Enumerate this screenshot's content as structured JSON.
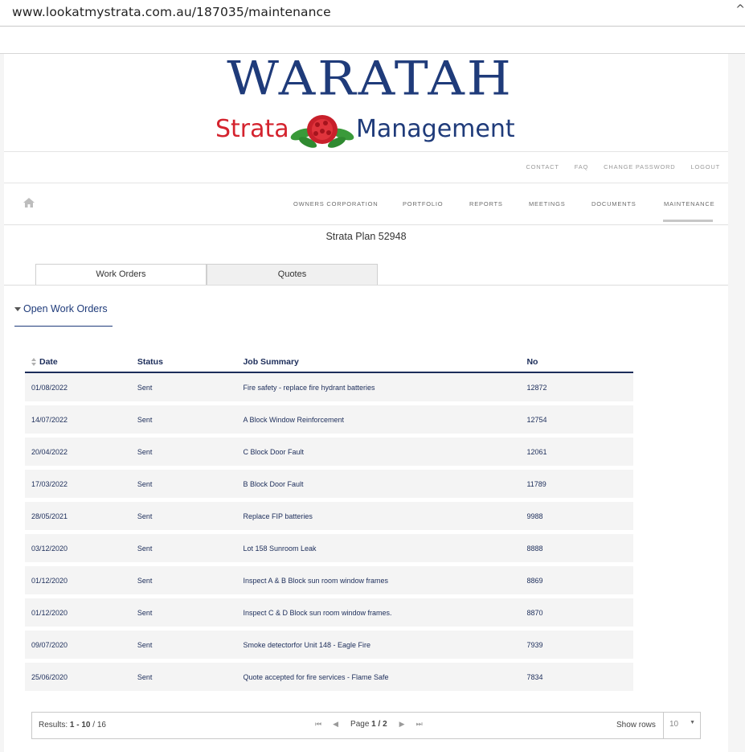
{
  "browser": {
    "url": "www.lookatmystrata.com.au/187035/maintenance",
    "corner_glyph": "^"
  },
  "logo": {
    "line1": "WARATAH",
    "line2_left": "Strata",
    "line2_right": "Management"
  },
  "top_links": [
    "CONTACT",
    "FAQ",
    "CHANGE PASSWORD",
    "LOGOUT"
  ],
  "main_nav": [
    "OWNERS CORPORATION",
    "PORTFOLIO",
    "REPORTS",
    "MEETINGS",
    "DOCUMENTS",
    "MAINTENANCE"
  ],
  "plan_title": "Strata Plan 52948",
  "tabs": {
    "work_orders": "Work Orders",
    "quotes": "Quotes"
  },
  "section_title": "Open Work Orders",
  "table": {
    "headers": [
      "Date",
      "Status",
      "Job Summary",
      "No"
    ],
    "rows": [
      [
        "01/08/2022",
        "Sent",
        "Fire safety - replace fire hydrant batteries",
        "12872"
      ],
      [
        "14/07/2022",
        "Sent",
        "A Block Window Reinforcement",
        "12754"
      ],
      [
        "20/04/2022",
        "Sent",
        "C Block Door Fault",
        "12061"
      ],
      [
        "17/03/2022",
        "Sent",
        "B Block Door Fault",
        "11789"
      ],
      [
        "28/05/2021",
        "Sent",
        "Replace FIP batteries",
        "9988"
      ],
      [
        "03/12/2020",
        "Sent",
        "Lot 158 Sunroom Leak",
        "8888"
      ],
      [
        "01/12/2020",
        "Sent",
        "Inspect A & B Block sun room window frames",
        "8869"
      ],
      [
        "01/12/2020",
        "Sent",
        "Inspect C & D Block sun room window frames.",
        "8870"
      ],
      [
        "09/07/2020",
        "Sent",
        "Smoke detectorfor Unit 148 - Eagle Fire",
        "7939"
      ],
      [
        "25/06/2020",
        "Sent",
        "Quote accepted for fire services - Flame Safe",
        "7834"
      ]
    ]
  },
  "pager": {
    "results_label": "Results:",
    "results_range": "1 - 10",
    "results_total": "/ 16",
    "page_label": "Page",
    "page_value": "1 / 2",
    "show_rows_label": "Show rows",
    "rows_value": "10"
  },
  "colors": {
    "brand_blue": "#1f3b7a",
    "brand_red": "#d4232e",
    "text_navy": "#1c2d5a"
  }
}
